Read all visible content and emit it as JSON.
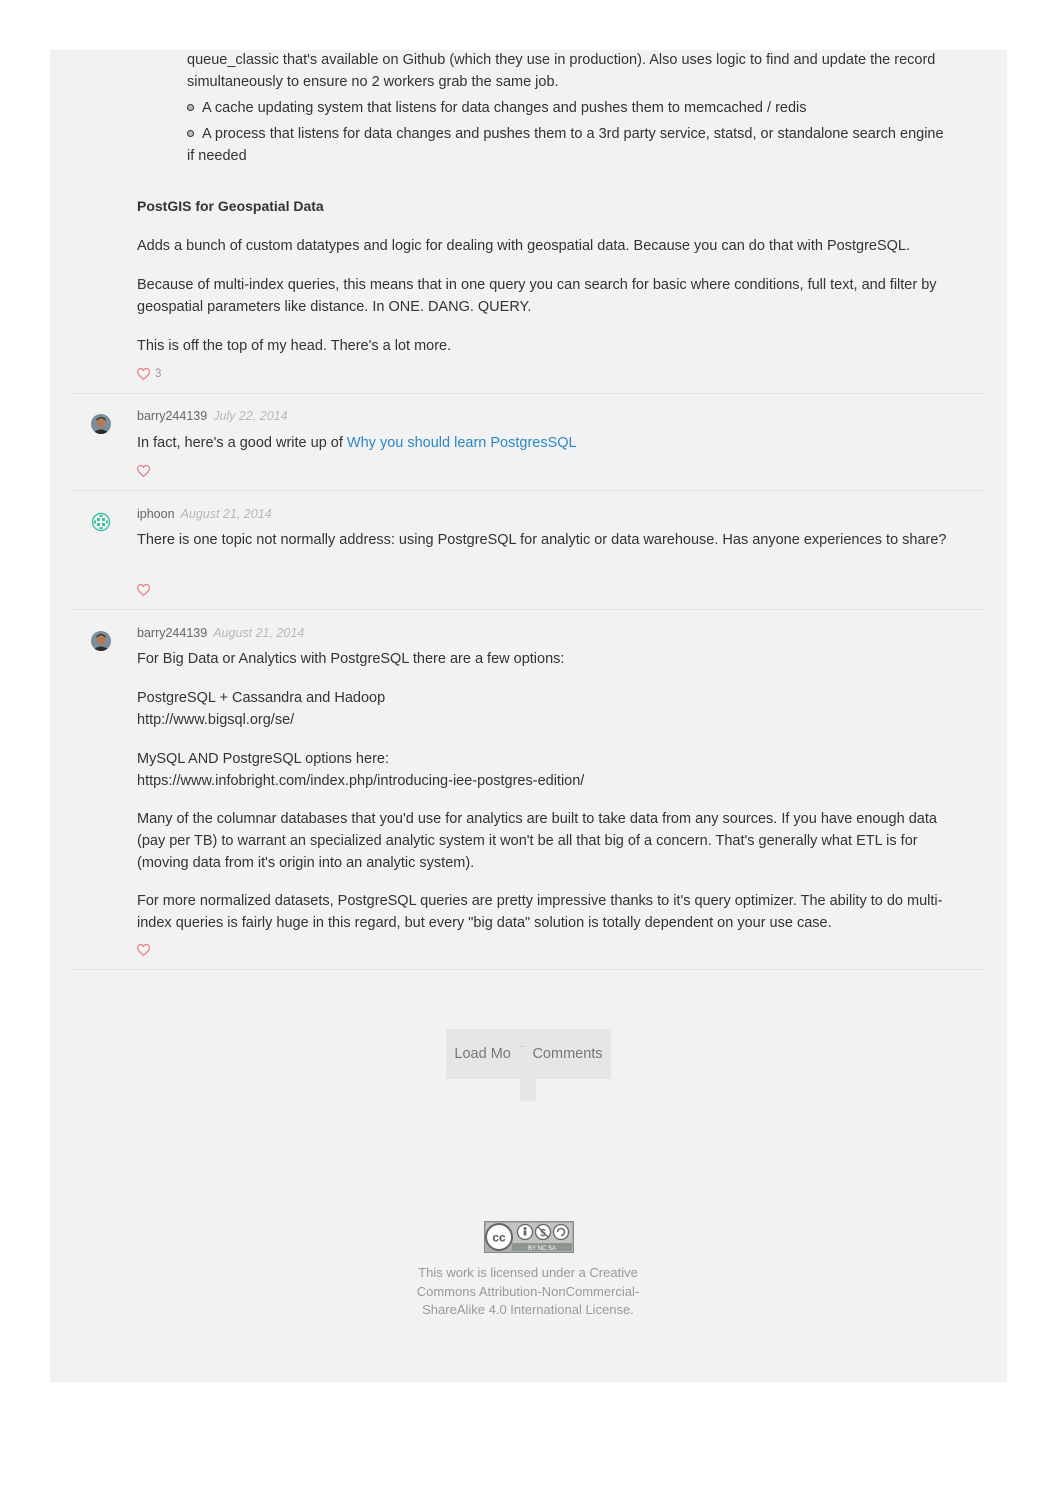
{
  "post": {
    "list_continuation": "queue_classic that's available on Github (which they use in production). Also uses logic to find and update the record simultaneously to ensure no 2 workers grab the same job.",
    "bullets": [
      "A cache updating system that listens for data changes and pushes them to memcached / redis",
      "A process that listens for data changes and pushes them to a 3rd party service, statsd, or standalone search engine if needed"
    ],
    "heading": "PostGIS for Geospatial Data",
    "paragraphs": [
      "Adds a bunch of custom datatypes and logic for dealing with geospatial data. Because you can do that with PostgreSQL.",
      "Because of multi-index queries, this means that in one query you can search for basic where conditions, full text, and filter by geospatial parameters like distance. In ONE. DANG. QUERY.",
      "This is off the top of my head. There's a lot more."
    ],
    "like_count": "3"
  },
  "comments": [
    {
      "author": "barry244139",
      "date": "July 22, 2014",
      "text_before_link": "In fact, here's a good write up of ",
      "link_text": "Why you should learn PostgresSQL"
    },
    {
      "author": "iphoon",
      "date": "August 21, 2014",
      "text": "There is one topic not normally address: using PostgreSQL for analytic or data warehouse. Has anyone experiences to share?"
    },
    {
      "author": "barry244139",
      "date": "August 21, 2014",
      "intro": "For Big Data or Analytics with PostgreSQL there are a few options:",
      "option1_title": "PostgreSQL + Cassandra and Hadoop",
      "option1_url": "http://www.bigsql.org/se/",
      "option2_title": "MySQL AND PostgreSQL options here:",
      "option2_url": "https://www.infobright.com/index.php/introducing-iee-postgres-edition/",
      "paragraph3": "Many of the columnar databases that you'd use for analytics are built to take data from any sources. If you have enough data (pay per TB) to warrant an specialized analytic system it won't be all that big of a concern. That's generally what ETL is for (moving data from it's origin into an analytic system).",
      "paragraph4": "For more normalized datasets, PostgreSQL queries are pretty impressive thanks to it's query optimizer. The ability to do multi-index queries is fairly huge in this regard, but every \"big data\" solution is totally dependent on your use case."
    }
  ],
  "load_more": {
    "label_part1": "Load Mo",
    "label_part2": "Comments"
  },
  "footer": {
    "license_text": "This work is licensed under a  Creative Commons Attribution-NonCommercial-ShareAlike 4.0 International License.",
    "badge_text": "BY  NC  SA"
  },
  "colors": {
    "panel_bg": "#f2f2f2",
    "link": "#2b88c4",
    "heart": "#e8707e",
    "identicon": "#3cc2a6"
  },
  "icons": {
    "like": "heart-outline-icon",
    "license": "creative-commons-badge-icon"
  }
}
